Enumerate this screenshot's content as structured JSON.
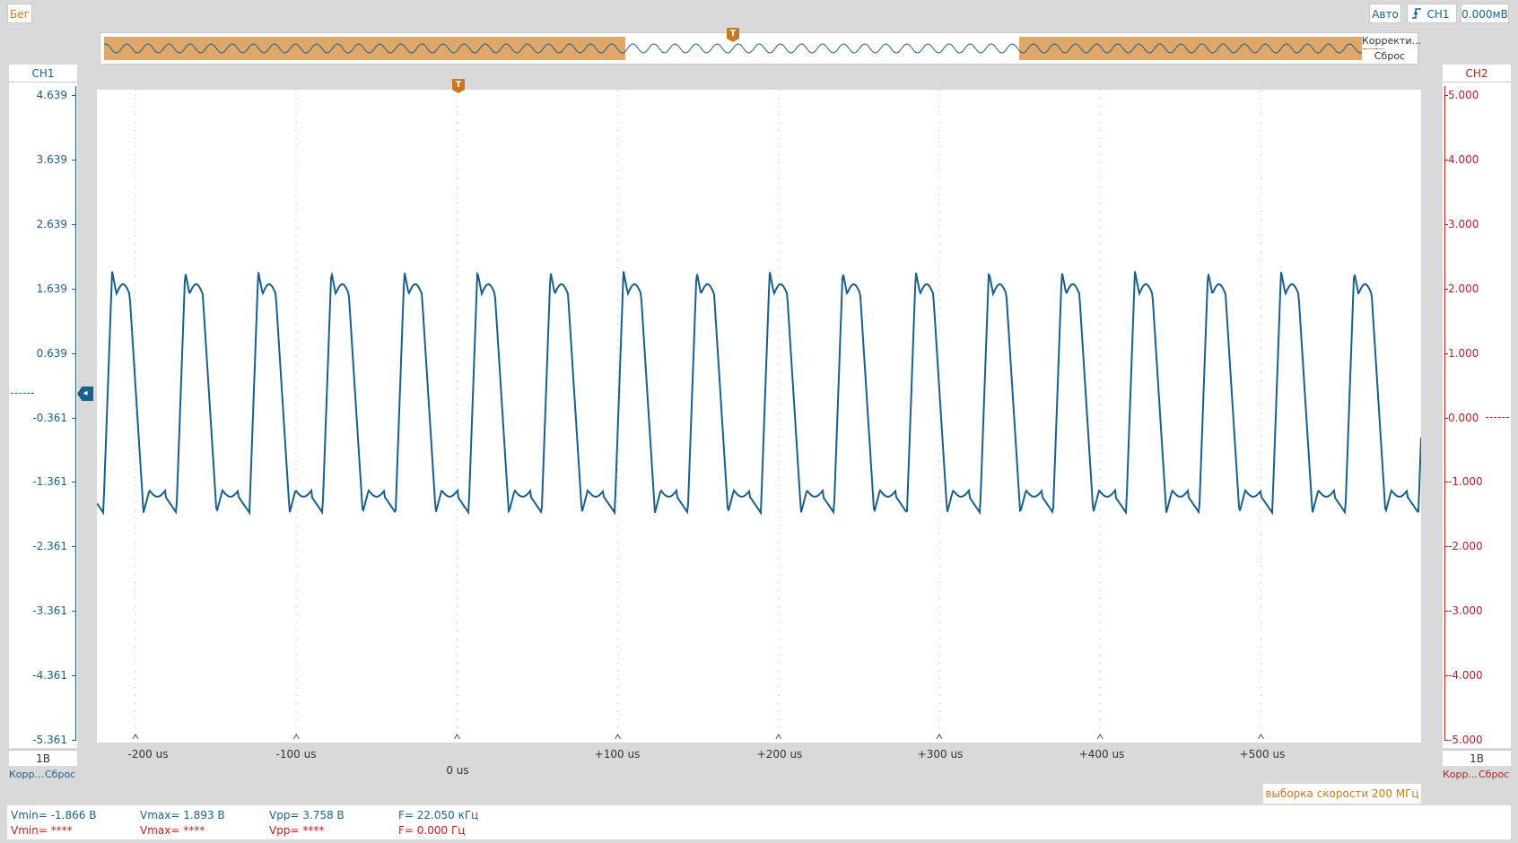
{
  "toolbar": {
    "run_label": "Бег",
    "mode_label": "Авто",
    "trigger_channel": "CH1",
    "trigger_level": "0.000мВ"
  },
  "overview": {
    "auto_label": "Корректи...",
    "reset_label": "Сброс",
    "trigger_marker": "T"
  },
  "ch1": {
    "name": "CH1",
    "scale": "1В",
    "auto_label": "Корр...",
    "reset_label": "Сброс",
    "ticks": [
      "4.639",
      "3.639",
      "2.639",
      "1.639",
      "0.639",
      "-0.361",
      "-1.361",
      "-2.361",
      "-3.361",
      "-4.361",
      "-5.361"
    ],
    "color": "#1a5f8a"
  },
  "ch2": {
    "name": "CH2",
    "scale": "1В",
    "auto_label": "Корр...",
    "reset_label": "Сброс",
    "ticks": [
      "5.000",
      "4.000",
      "3.000",
      "2.000",
      "1.000",
      "0.000",
      "-1.000",
      "-2.000",
      "-3.000",
      "-4.000",
      "-5.000"
    ],
    "color": "#b22222"
  },
  "time_axis": {
    "labels": [
      "-200 us",
      "-100 us",
      "0 us",
      "+100 us",
      "+200 us",
      "+300 us",
      "+400 us",
      "+500 us"
    ],
    "trigger_marker": "T"
  },
  "sample_rate": "выборка скорости 200 МГц",
  "measurements": {
    "ch1": {
      "vmin": "Vmin= -1.866 В",
      "vmax": "Vmax= 1.893 В",
      "vpp": "Vpp= 3.758 В",
      "freq": "F= 22.050 кГц"
    },
    "ch2": {
      "vmin": "Vmin= ****",
      "vmax": "Vmax= ****",
      "vpp": "Vpp= ****",
      "freq": "F= 0.000 Гц"
    }
  },
  "chart_data": {
    "type": "line",
    "series": [
      {
        "name": "CH1",
        "period_us": 45.35,
        "vmax": 1.893,
        "vmin": -1.866
      }
    ],
    "x_range_us": [
      -222,
      600
    ],
    "ylim": [
      -5.361,
      4.639
    ],
    "grid": true
  }
}
